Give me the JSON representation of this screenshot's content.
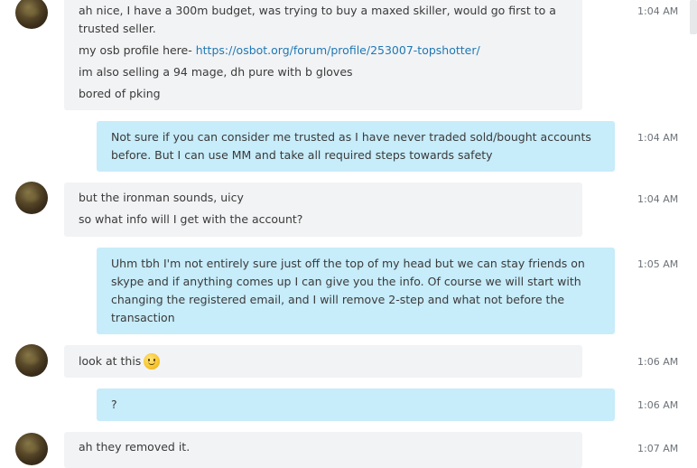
{
  "messages": [
    {
      "lines": [
        "ah nice, I have a 300m budget, was trying to buy a maxed skiller, would go first to a",
        "trusted seller."
      ],
      "extra_lines": [
        {
          "text": "my osb profile here- ",
          "link": "https://osbot.org/forum/profile/253007-topshotter/"
        },
        {
          "text": "im also selling a 94 mage, dh pure with b gloves"
        },
        {
          "text": "bored of pking"
        }
      ],
      "time": "1:04 AM"
    },
    {
      "lines": [
        "Not sure if you can consider me trusted as I have never traded sold/bought accounts",
        "before. But I can use MM and take all required steps towards safety"
      ],
      "time": "1:04 AM"
    },
    {
      "lines": [
        "but the ironman sounds, uicy",
        "so what info will I get with the account?"
      ],
      "time": "1:04 AM"
    },
    {
      "lines": [
        "Uhm tbh I'm not entirely sure just off the top of my head but we can stay friends on",
        "skype and if anything comes up I can give you the info. Of course we will start with",
        "changing the registered email, and I will remove 2-step and what not before the",
        "transaction"
      ],
      "time": "1:05 AM"
    },
    {
      "text": "look at this",
      "emoji": "smile-emoticon",
      "time": "1:06 AM"
    },
    {
      "text": "?",
      "time": "1:06 AM"
    },
    {
      "text": "ah they removed it.",
      "time": "1:07 AM"
    }
  ]
}
